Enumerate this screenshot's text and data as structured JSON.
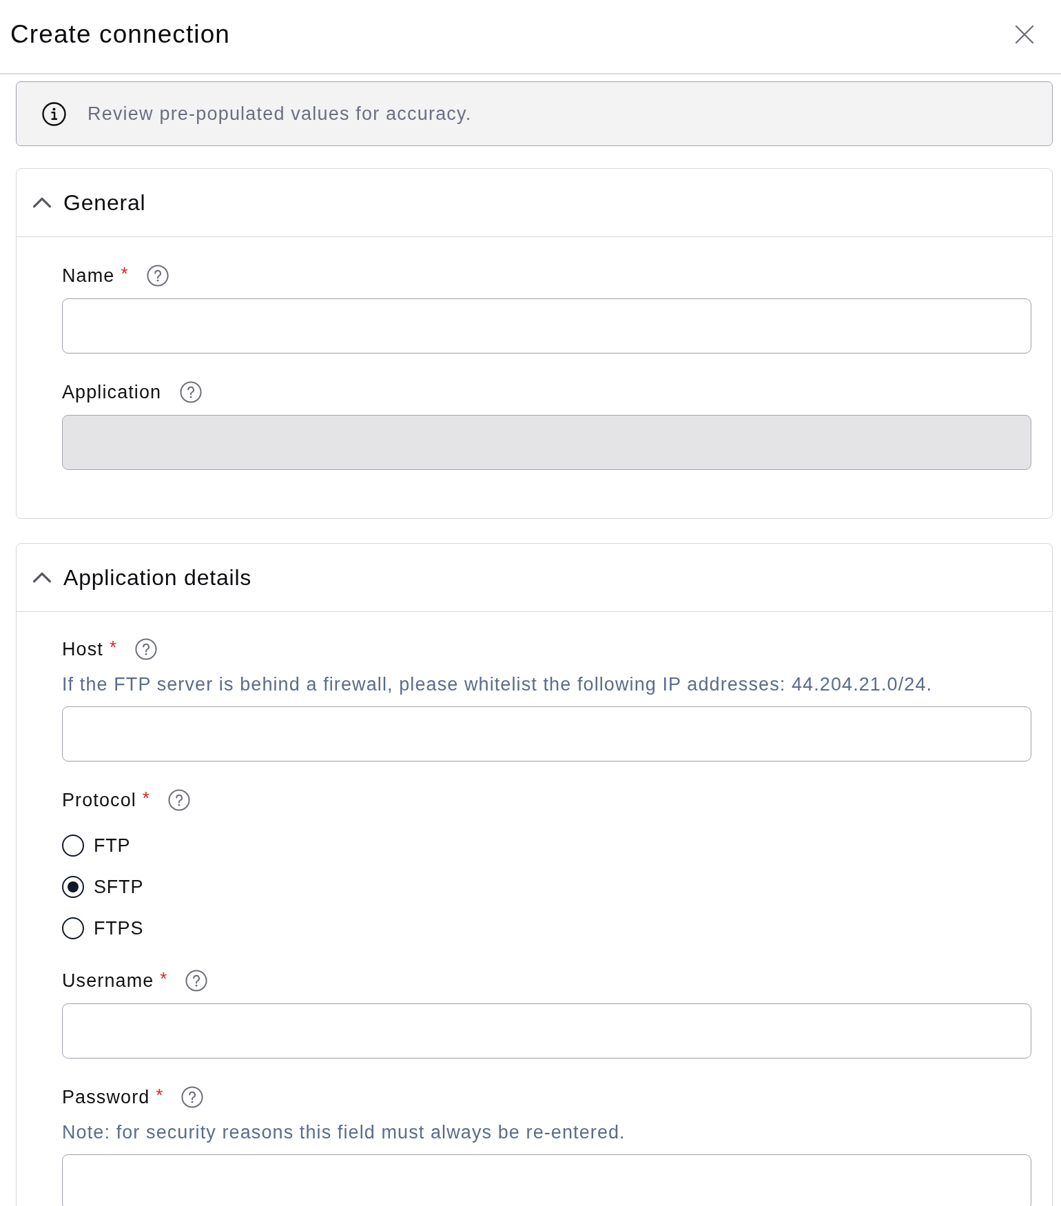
{
  "dialog": {
    "title": "Create connection"
  },
  "banner": {
    "text": "Review pre-populated values for accuracy."
  },
  "sections": [
    {
      "title": "General",
      "expanded": true,
      "fields": [
        {
          "kind": "text",
          "label": "Name",
          "required_mark": "*",
          "disabled": false
        },
        {
          "kind": "text",
          "label": "Application",
          "disabled": true
        }
      ]
    },
    {
      "title": "Application details",
      "expanded": true,
      "fields": [
        {
          "kind": "text",
          "label": "Host",
          "required_mark": "*",
          "hint": "If the FTP server is behind a firewall, please whitelist the following IP addresses: 44.204.21.0/24.",
          "disabled": false
        },
        {
          "kind": "radio",
          "label": "Protocol",
          "required_mark": "*",
          "options": [
            {
              "label": "FTP",
              "selected": false
            },
            {
              "label": "SFTP",
              "selected": true
            },
            {
              "label": "FTPS",
              "selected": false
            }
          ]
        },
        {
          "kind": "text",
          "label": "Username",
          "required_mark": "*",
          "disabled": false
        },
        {
          "kind": "text",
          "label": "Password",
          "required_mark": "*",
          "hint": "Note: for security reasons this field must always be re-entered.",
          "disabled": false
        }
      ]
    }
  ]
}
